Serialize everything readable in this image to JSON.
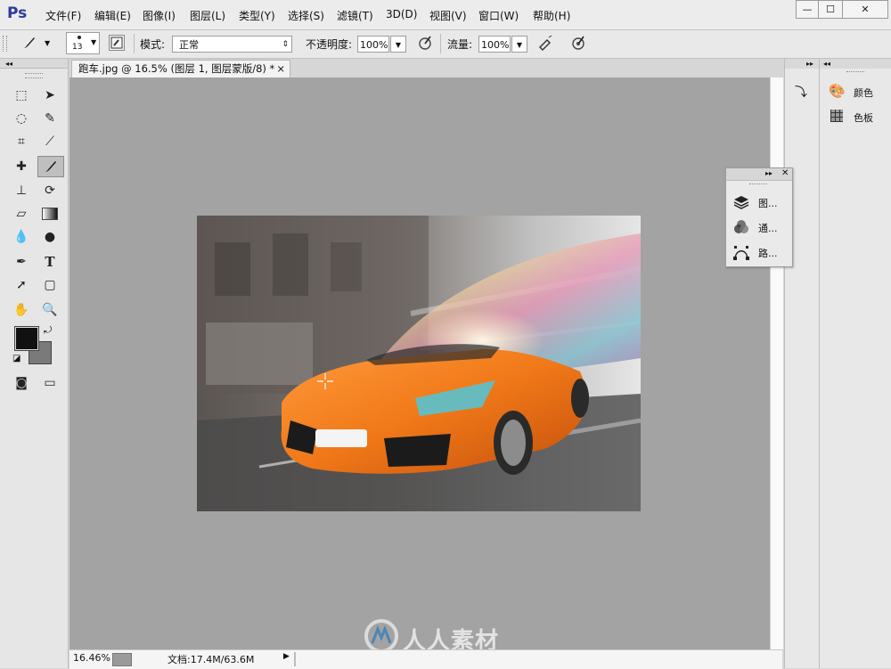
{
  "app": {
    "logo": "Ps"
  },
  "menu": [
    "文件(F)",
    "编辑(E)",
    "图像(I)",
    "图层(L)",
    "类型(Y)",
    "选择(S)",
    "滤镜(T)",
    "3D(D)",
    "视图(V)",
    "窗口(W)",
    "帮助(H)"
  ],
  "window_controls": {
    "minimize": "—",
    "maximize": "☐",
    "close": "✕"
  },
  "options": {
    "brush_size": "13",
    "mode_label": "模式:",
    "mode_value": "正常",
    "opacity_label": "不透明度:",
    "opacity_value": "100%",
    "flow_label": "流量:",
    "flow_value": "100%"
  },
  "document": {
    "tab_title": "跑车.jpg @ 16.5% (图层 1, 图层蒙版/8) *",
    "tab_close": "×"
  },
  "status": {
    "zoom": "16.46%",
    "doc_info": "文档:17.4M/63.6M",
    "arrow": "▶"
  },
  "panels": {
    "color": "颜色",
    "swatches": "色板",
    "layers": "图...",
    "channels": "通...",
    "paths": "路..."
  },
  "icons": {
    "brush": "brush-icon",
    "marquee": "marquee-icon",
    "move": "move-icon",
    "lasso": "lasso-icon",
    "quick-select": "quick-select-icon",
    "crop": "crop-icon",
    "eyedropper": "eyedropper-icon",
    "healing": "healing-brush-icon",
    "stamp": "clone-stamp-icon",
    "history-brush": "history-brush-icon",
    "eraser": "eraser-icon",
    "gradient": "gradient-icon",
    "blur": "blur-icon",
    "dodge": "dodge-icon",
    "pen": "pen-icon",
    "type": "type-icon",
    "path-select": "path-select-icon",
    "shape": "rectangle-shape-icon",
    "hand": "hand-icon",
    "zoom": "zoom-icon"
  },
  "colors": {
    "foreground": "#111111",
    "background": "#7a7a7a",
    "accent": "#2a3b9a",
    "canvas_bg": "#a3a3a3"
  },
  "watermark_text": "人人素材"
}
